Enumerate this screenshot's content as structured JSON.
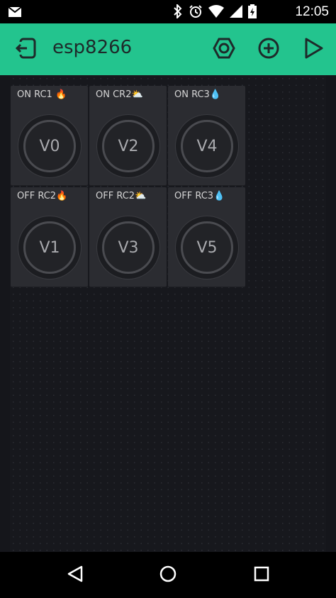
{
  "status_bar": {
    "time": "12:05",
    "icons": [
      "mail-icon",
      "bluetooth-icon",
      "alarm-icon",
      "wifi-icon",
      "cell-signal-icon",
      "battery-charging-icon"
    ]
  },
  "app_bar": {
    "title": "esp8266",
    "icons": [
      "exit-project-icon",
      "settings-hex-icon",
      "add-widget-icon",
      "play-icon"
    ],
    "color": "#23c48e"
  },
  "widgets": [
    {
      "label": "ON RC1 🔥",
      "pin": "V0"
    },
    {
      "label": "ON CR2⛅",
      "pin": "V2"
    },
    {
      "label": "ON RC3💧",
      "pin": "V4"
    },
    {
      "label": "OFF RC2🔥",
      "pin": "V1"
    },
    {
      "label": "OFF RC2⛅",
      "pin": "V3"
    },
    {
      "label": "OFF RC3💧",
      "pin": "V5"
    }
  ],
  "nav_bar": {
    "icons": [
      "back-icon",
      "home-icon",
      "recents-icon"
    ]
  }
}
